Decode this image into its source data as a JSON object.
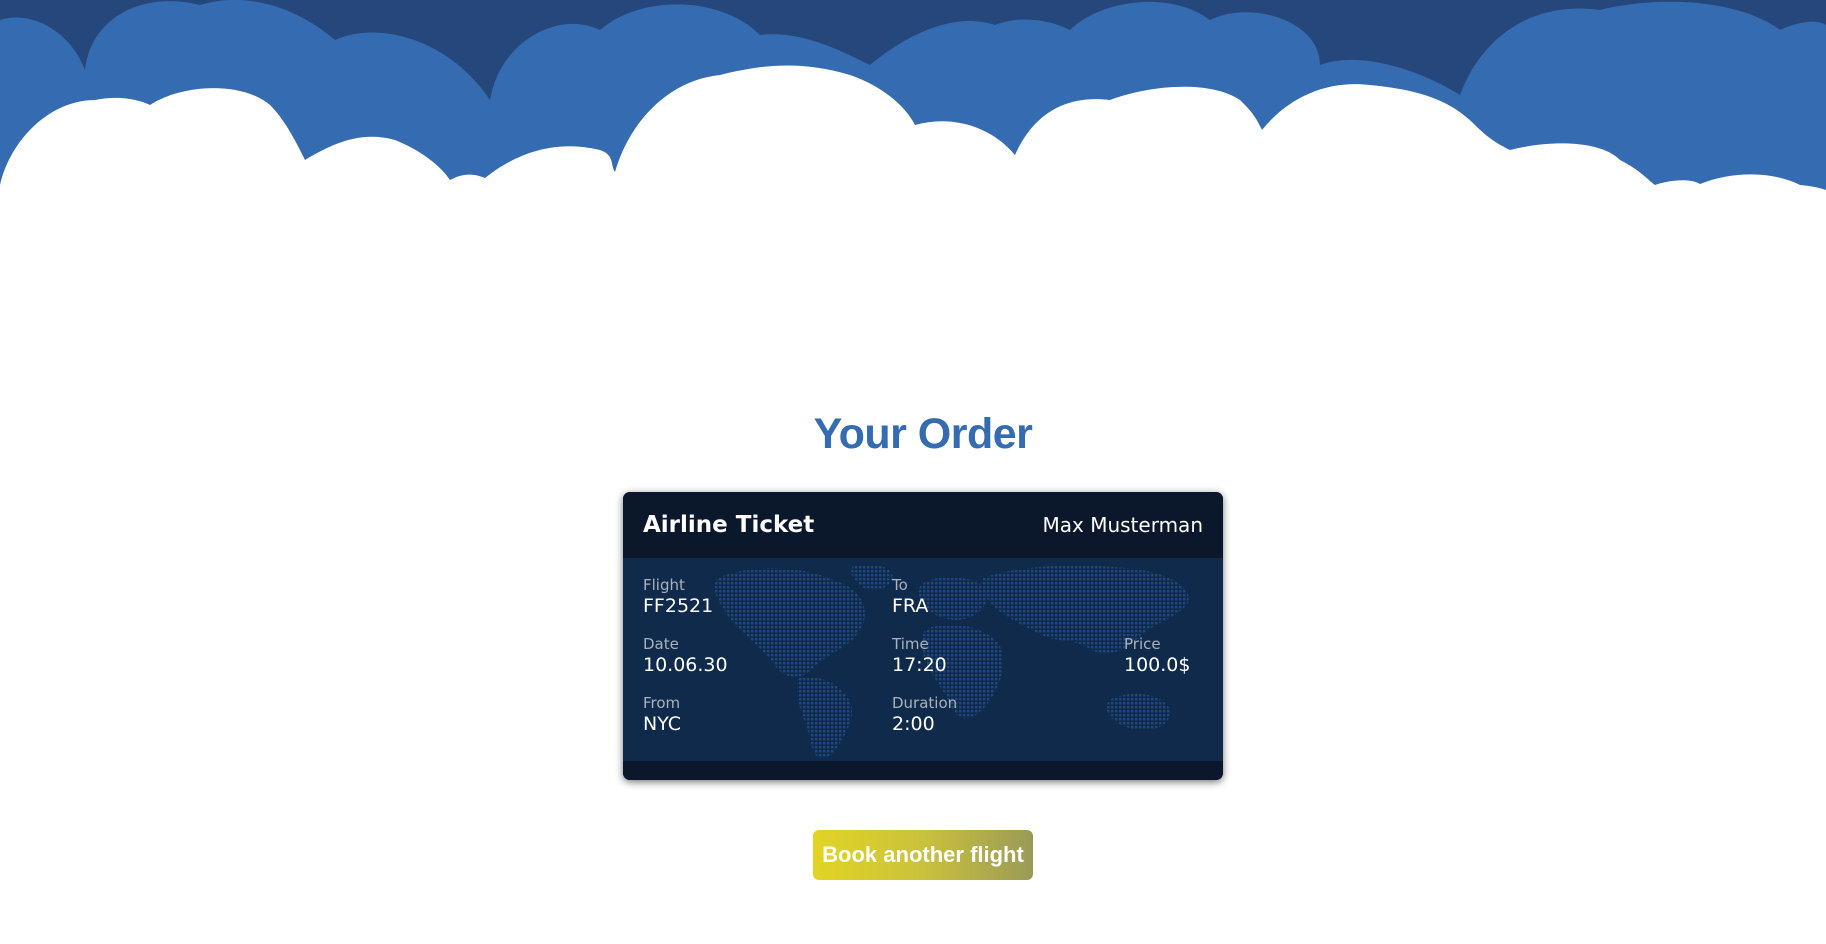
{
  "colors": {
    "sky_dark": "#25477c",
    "sky_mid": "#356bb1",
    "cloud": "#ffffff",
    "title": "#356bb1",
    "ticket_header": "#0b172a",
    "ticket_body": "#0f2a4b",
    "button_gradient_start": "#e2d424",
    "button_gradient_end": "#9a9a58"
  },
  "page": {
    "title": "Your Order"
  },
  "ticket": {
    "title": "Airline Ticket",
    "passenger": "Max Musterman",
    "background_icon": "world-map-icon",
    "fields": {
      "flight": {
        "label": "Flight",
        "value": "FF2521"
      },
      "to": {
        "label": "To",
        "value": "FRA"
      },
      "date": {
        "label": "Date",
        "value": "10.06.30"
      },
      "time": {
        "label": "Time",
        "value": "17:20"
      },
      "price": {
        "label": "Price",
        "value": "100.0$"
      },
      "from": {
        "label": "From",
        "value": "NYC"
      },
      "duration": {
        "label": "Duration",
        "value": "2:00"
      }
    }
  },
  "actions": {
    "book_another": "Book another flight"
  }
}
